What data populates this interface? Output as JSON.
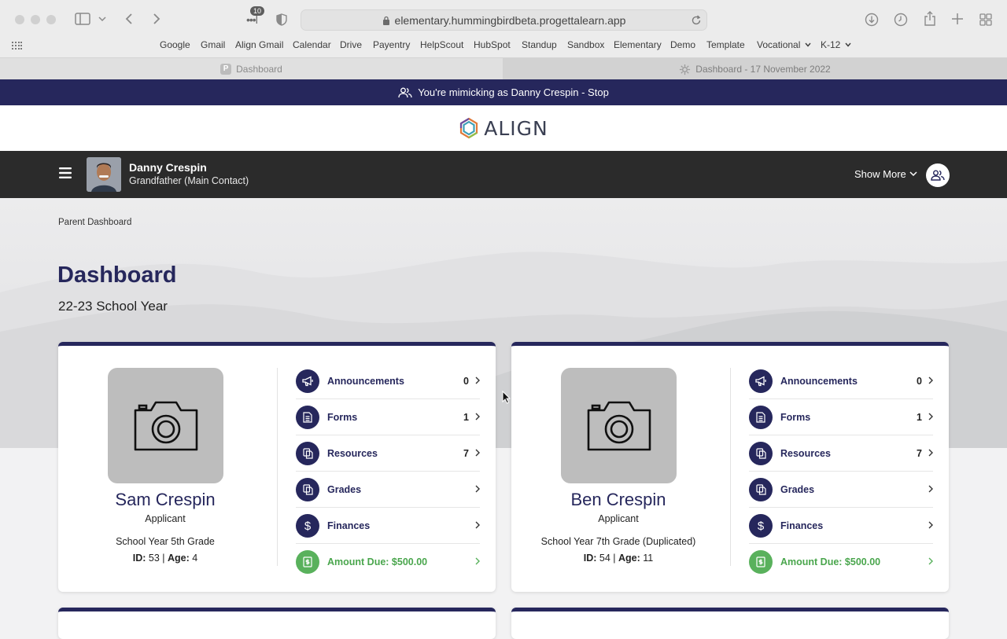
{
  "browser": {
    "tab_count_badge": "10",
    "url": "elementary.hummingbirdbeta.progettalearn.app",
    "bookmarks": [
      "Google",
      "Gmail",
      "Align Gmail",
      "Calendar",
      "Drive",
      "Payentry",
      "HelpScout",
      "HubSpot",
      "Standup",
      "Sandbox",
      "Elementary",
      "Demo",
      "Template",
      "Vocational",
      "K-12"
    ],
    "tabs": [
      {
        "title": "Dashboard"
      },
      {
        "title": "Dashboard - 17 November 2022"
      }
    ]
  },
  "mimic_banner": "You're mimicking as Danny Crespin - Stop",
  "logo_text": "ALIGN",
  "user": {
    "name": "Danny Crespin",
    "role": "Grandfather (Main Contact)",
    "show_more": "Show More"
  },
  "breadcrumb": "Parent Dashboard",
  "page_title": "Dashboard",
  "school_year": "22-23 School Year",
  "students": [
    {
      "name": "Sam Crespin",
      "status": "Applicant",
      "grade": "School Year 5th Grade",
      "id_label": "ID:",
      "id": "53",
      "age_label": "Age:",
      "age": "4",
      "rows": [
        {
          "label": "Announcements",
          "count": "0",
          "icon": "megaphone-icon"
        },
        {
          "label": "Forms",
          "count": "1",
          "icon": "document-icon"
        },
        {
          "label": "Resources",
          "count": "7",
          "icon": "copy-icon"
        },
        {
          "label": "Grades",
          "count": "",
          "icon": "copy-icon"
        },
        {
          "label": "Finances",
          "count": "",
          "icon": "dollar-icon"
        },
        {
          "label": "Amount Due: $500.00",
          "count": "",
          "icon": "invoice-icon"
        }
      ]
    },
    {
      "name": "Ben Crespin",
      "status": "Applicant",
      "grade": "School Year 7th Grade (Duplicated)",
      "id_label": "ID:",
      "id": "54",
      "age_label": "Age:",
      "age": "11",
      "rows": [
        {
          "label": "Announcements",
          "count": "0",
          "icon": "megaphone-icon"
        },
        {
          "label": "Forms",
          "count": "1",
          "icon": "document-icon"
        },
        {
          "label": "Resources",
          "count": "7",
          "icon": "copy-icon"
        },
        {
          "label": "Grades",
          "count": "",
          "icon": "copy-icon"
        },
        {
          "label": "Finances",
          "count": "",
          "icon": "dollar-icon"
        },
        {
          "label": "Amount Due: $500.00",
          "count": "",
          "icon": "invoice-icon"
        }
      ]
    }
  ],
  "colors": {
    "navy": "#26275c",
    "green": "#59b15c",
    "dark_bar": "#2b2b2b"
  }
}
